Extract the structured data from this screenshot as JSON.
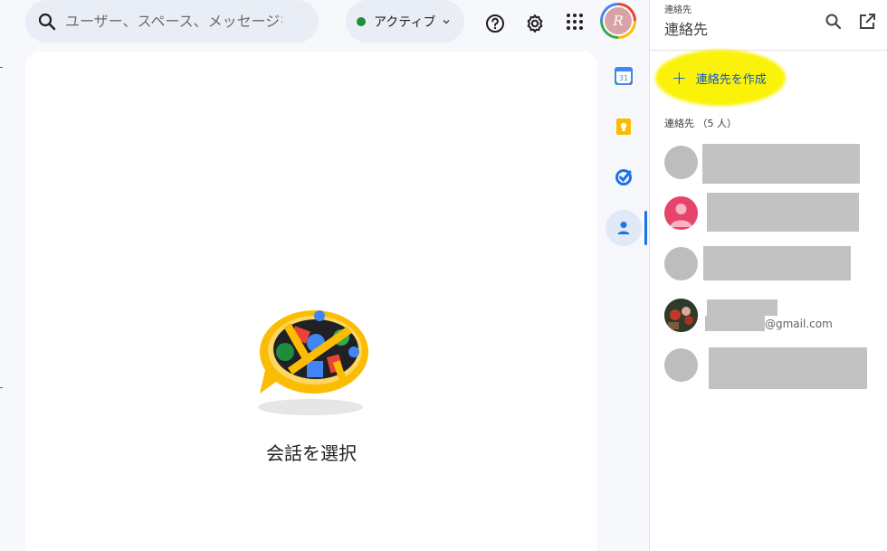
{
  "header": {
    "search_placeholder": "ユーザー、スペース、メッセージを検索",
    "status_label": "アクティブ",
    "status_color": "#1e8e3e",
    "help_icon": "help-icon",
    "settings_icon": "gear-icon",
    "apps_icon": "apps-grid-icon",
    "avatar_letter": "R"
  },
  "main": {
    "empty_message": "会話を選択"
  },
  "rail": {
    "items": [
      {
        "name": "calendar",
        "icon": "calendar-icon",
        "badge": "31"
      },
      {
        "name": "keep",
        "icon": "keep-icon"
      },
      {
        "name": "tasks",
        "icon": "tasks-icon"
      },
      {
        "name": "contacts",
        "icon": "contacts-icon",
        "active": true
      }
    ]
  },
  "contacts_panel": {
    "small_title": "連絡先",
    "title": "連絡先",
    "create_label": "連絡先を作成",
    "count_label": "連絡先 （5 人）",
    "contacts": [
      {
        "avatar": "gray"
      },
      {
        "avatar": "pink-person"
      },
      {
        "avatar": "gray"
      },
      {
        "avatar": "photo",
        "email": "@gmail.com"
      },
      {
        "avatar": "gray"
      }
    ]
  },
  "colors": {
    "accent": "#0b57d0",
    "highlight": "#fbf20a",
    "background": "#f6f8fc"
  }
}
